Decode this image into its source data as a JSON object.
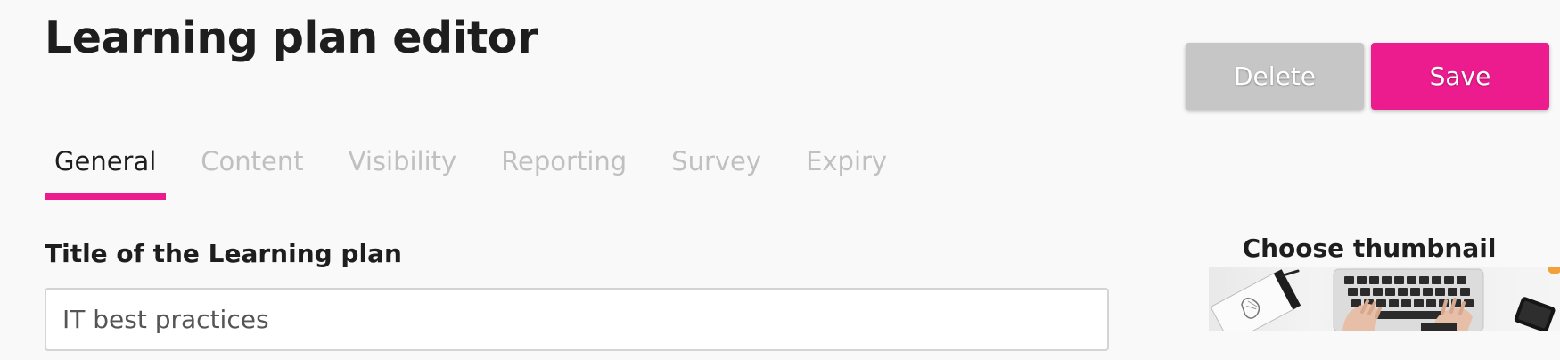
{
  "header": {
    "title": "Learning plan editor"
  },
  "actions": {
    "delete_label": "Delete",
    "save_label": "Save"
  },
  "tabs": [
    {
      "label": "General",
      "active": true
    },
    {
      "label": "Content",
      "active": false
    },
    {
      "label": "Visibility",
      "active": false
    },
    {
      "label": "Reporting",
      "active": false
    },
    {
      "label": "Survey",
      "active": false
    },
    {
      "label": "Expiry",
      "active": false
    }
  ],
  "form": {
    "title_label": "Title of the Learning plan",
    "title_value": "IT best practices"
  },
  "thumbnail": {
    "label": "Choose thumbnail",
    "icon": "laptop-photo"
  },
  "colors": {
    "accent": "#ec1c8f",
    "delete_button": "#c6c6c6",
    "tab_inactive": "#c0c0c0"
  }
}
